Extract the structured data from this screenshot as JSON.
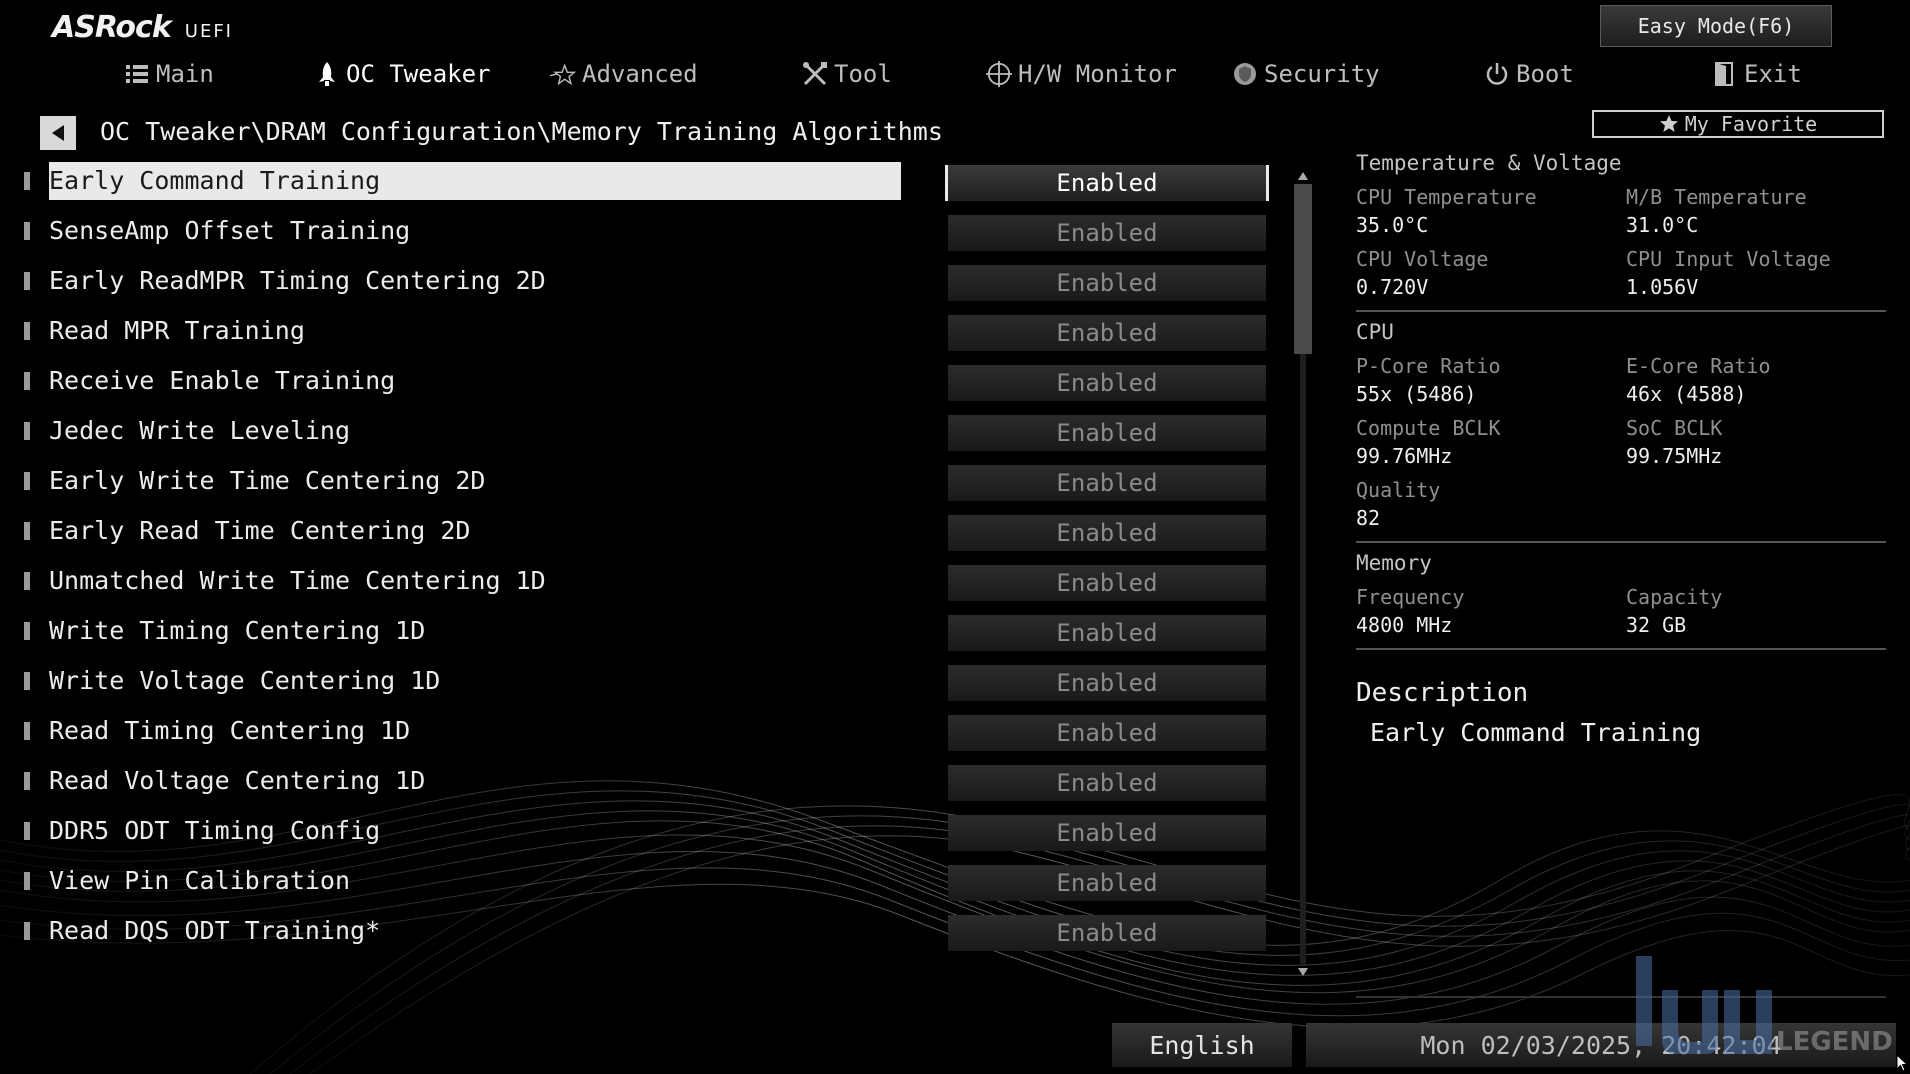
{
  "header": {
    "brand": "ASRock",
    "brand_sub": "UEFI",
    "easy_mode_label": "Easy Mode(F6)",
    "tabs": [
      {
        "label": "Main",
        "icon": "list-icon"
      },
      {
        "label": "OC Tweaker",
        "icon": "rocket-icon"
      },
      {
        "label": "Advanced",
        "icon": "star-icon"
      },
      {
        "label": "Tool",
        "icon": "tools-icon"
      },
      {
        "label": "H/W Monitor",
        "icon": "crosshair-icon"
      },
      {
        "label": "Security",
        "icon": "shield-icon"
      },
      {
        "label": "Boot",
        "icon": "power-icon"
      },
      {
        "label": "Exit",
        "icon": "exit-door-icon"
      }
    ],
    "active_tab": "OC Tweaker"
  },
  "breadcrumb": "OC Tweaker\\DRAM Configuration\\Memory Training Algorithms",
  "my_favorite_label": "My Favorite",
  "settings": [
    {
      "label": "Early Command Training",
      "value": "Enabled"
    },
    {
      "label": "SenseAmp Offset Training",
      "value": "Enabled"
    },
    {
      "label": "Early ReadMPR Timing Centering 2D",
      "value": "Enabled"
    },
    {
      "label": "Read MPR Training",
      "value": "Enabled"
    },
    {
      "label": "Receive Enable Training",
      "value": "Enabled"
    },
    {
      "label": "Jedec Write Leveling",
      "value": "Enabled"
    },
    {
      "label": "Early Write Time Centering 2D",
      "value": "Enabled"
    },
    {
      "label": "Early Read Time Centering 2D",
      "value": "Enabled"
    },
    {
      "label": "Unmatched Write Time Centering 1D",
      "value": "Enabled"
    },
    {
      "label": "Write Timing Centering 1D",
      "value": "Enabled"
    },
    {
      "label": "Write Voltage Centering 1D",
      "value": "Enabled"
    },
    {
      "label": "Read Timing Centering 1D",
      "value": "Enabled"
    },
    {
      "label": "Read Voltage Centering 1D",
      "value": "Enabled"
    },
    {
      "label": "DDR5 ODT Timing Config",
      "value": "Enabled"
    },
    {
      "label": "View Pin Calibration",
      "value": "Enabled"
    },
    {
      "label": "Read DQS ODT Training*",
      "value": "Enabled"
    }
  ],
  "selected_index": 0,
  "hw_monitor": {
    "temp_voltage_title": "Temperature & Voltage",
    "cpu_temp_label": "CPU Temperature",
    "cpu_temp": "35.0°C",
    "mb_temp_label": "M/B Temperature",
    "mb_temp": "31.0°C",
    "cpu_voltage_label": "CPU Voltage",
    "cpu_voltage": "0.720V",
    "cpu_input_voltage_label": "CPU Input Voltage",
    "cpu_input_voltage": "1.056V",
    "cpu_title": "CPU",
    "pcore_label": "P-Core Ratio",
    "pcore": "55x (5486)",
    "ecore_label": "E-Core Ratio",
    "ecore": "46x (4588)",
    "compute_bclk_label": "Compute BCLK",
    "compute_bclk": "99.76MHz",
    "soc_bclk_label": "SoC BCLK",
    "soc_bclk": "99.75MHz",
    "quality_label": "Quality",
    "quality": "82",
    "memory_title": "Memory",
    "freq_label": "Frequency",
    "freq": "4800 MHz",
    "capacity_label": "Capacity",
    "capacity": "32 GB"
  },
  "description": {
    "title": "Description",
    "text": "Early Command Training"
  },
  "footer": {
    "language": "English",
    "datetime": "Mon 02/03/2025, 20:42:04"
  },
  "watermark": "LEGEND"
}
